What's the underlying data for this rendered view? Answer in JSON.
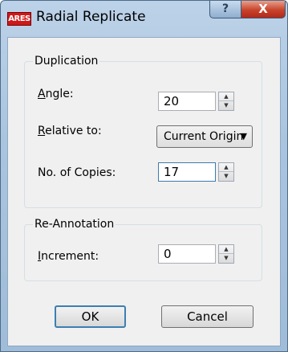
{
  "window": {
    "title": "Radial Replicate",
    "app_icon_text": "ARES",
    "help_glyph": "?",
    "close_glyph": "X"
  },
  "duplication": {
    "legend": "Duplication",
    "angle": {
      "label_underlined": "A",
      "label_rest": "ngle:",
      "value": "20"
    },
    "relative_to": {
      "label_underlined": "R",
      "label_rest": "elative to:",
      "selected": "Current Origin"
    },
    "copies": {
      "label": "No. of Copies:",
      "value": "17"
    }
  },
  "reannotation": {
    "legend": "Re-Annotation",
    "increment": {
      "label_underlined": "I",
      "label_rest": "ncrement:",
      "value": "0"
    }
  },
  "buttons": {
    "ok": "OK",
    "cancel": "Cancel"
  },
  "icons": {
    "spin_up": "▲",
    "spin_down": "▼",
    "dropdown": "▼"
  }
}
